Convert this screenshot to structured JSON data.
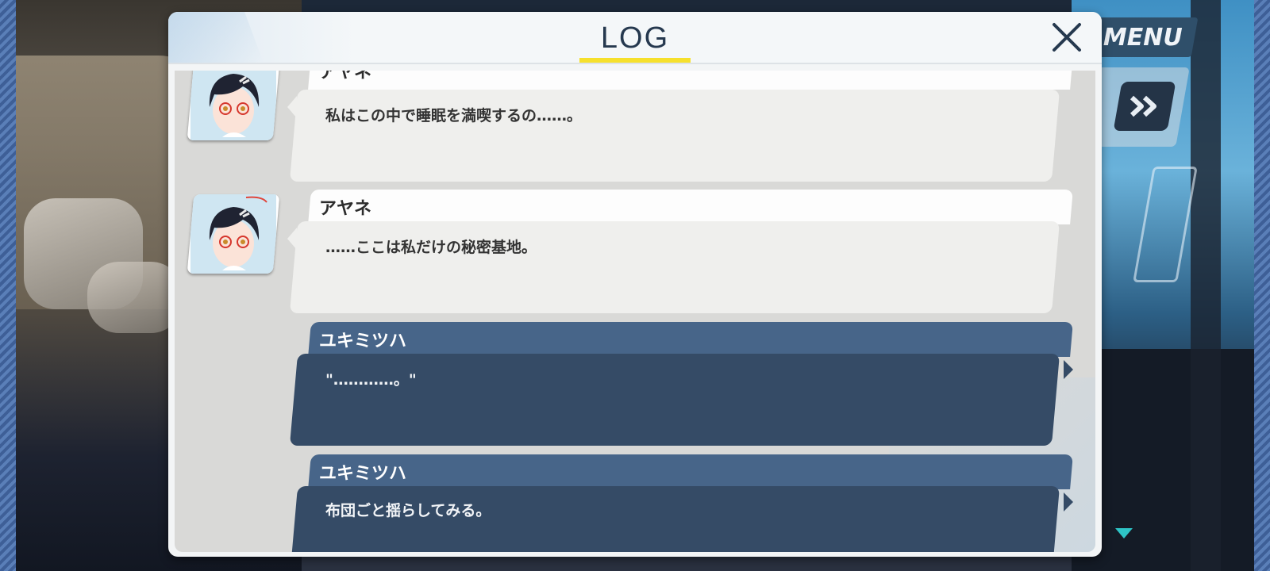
{
  "hud": {
    "menu_label": "MENU"
  },
  "log": {
    "title": "LOG",
    "entries": [
      {
        "speaker": "アヤネ",
        "text": "私はこの中で睡眠を満喫するの……。",
        "side": "character",
        "avatar": "ayane-portrait"
      },
      {
        "speaker": "アヤネ",
        "text": "……ここは私だけの秘密基地。",
        "side": "character",
        "avatar": "ayane-portrait"
      },
      {
        "speaker": "ユキミツハ",
        "text": "\"…………。\"",
        "side": "player"
      },
      {
        "speaker": "ユキミツハ",
        "text": "布団ごと揺らしてみる。",
        "side": "player"
      }
    ]
  },
  "colors": {
    "title_underline": "#f6e02c",
    "player_bubble": "#354b66",
    "player_name_tab": "#476589",
    "character_bubble": "#efefed",
    "scroll_indicator": "#2ec4c6"
  }
}
